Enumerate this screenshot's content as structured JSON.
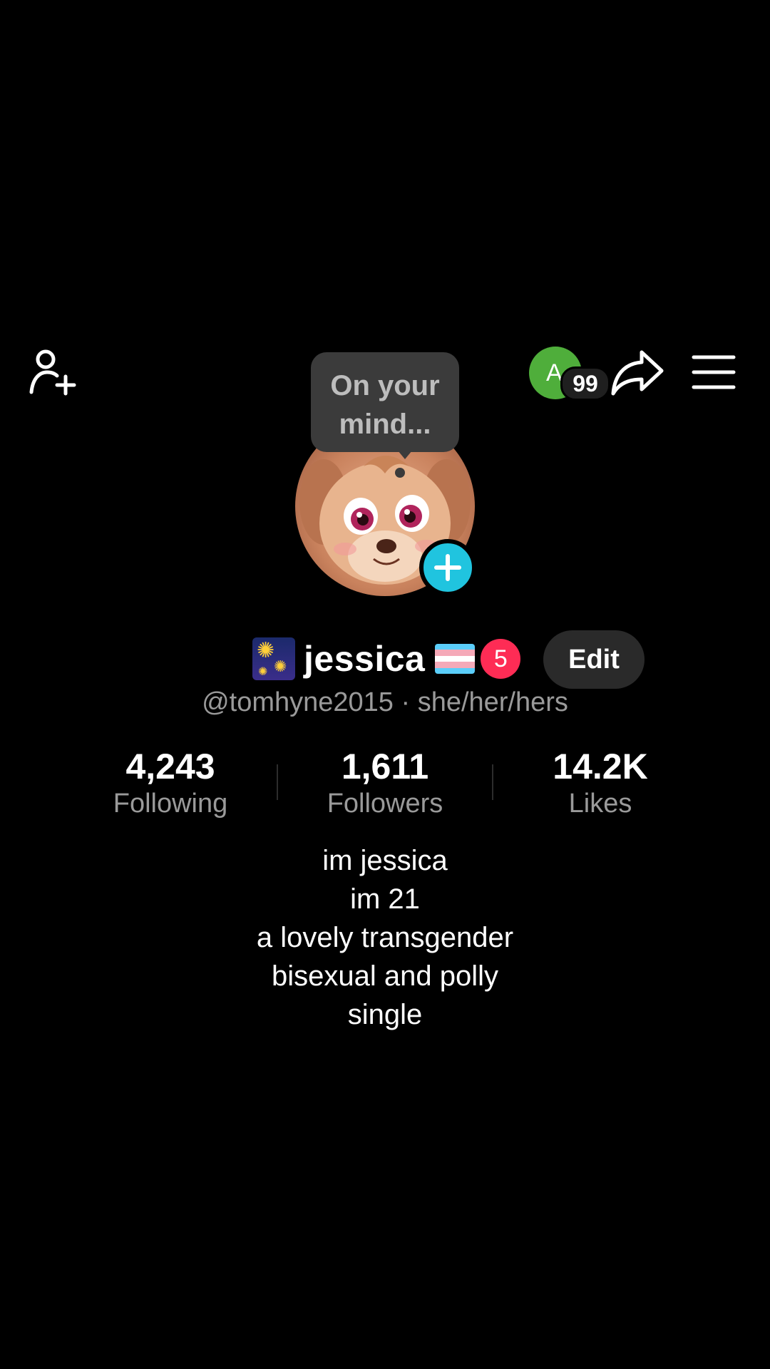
{
  "header": {
    "add_friend_icon": "person-plus-icon",
    "avatar_initial": "A",
    "notification_count": "99",
    "share_icon": "share-arrow-icon",
    "menu_icon": "hamburger-menu-icon"
  },
  "profile": {
    "bubble_text": "On your mind...",
    "add_story_icon": "plus-icon",
    "name": "jessica",
    "badge_count": "5",
    "edit_label": "Edit",
    "handle_line": "@tomhyne2015 · she/her/hers",
    "colors": {
      "accent_add": "#20c4df",
      "badge": "#fe2c55",
      "avatar_small": "#4fae3b"
    }
  },
  "stats": [
    {
      "value": "4,243",
      "label": "Following"
    },
    {
      "value": "1,611",
      "label": "Followers"
    },
    {
      "value": "14.2K",
      "label": "Likes"
    }
  ],
  "bio": [
    "im jessica",
    "im 21",
    "a lovely transgender",
    "bisexual and polly",
    "single"
  ]
}
